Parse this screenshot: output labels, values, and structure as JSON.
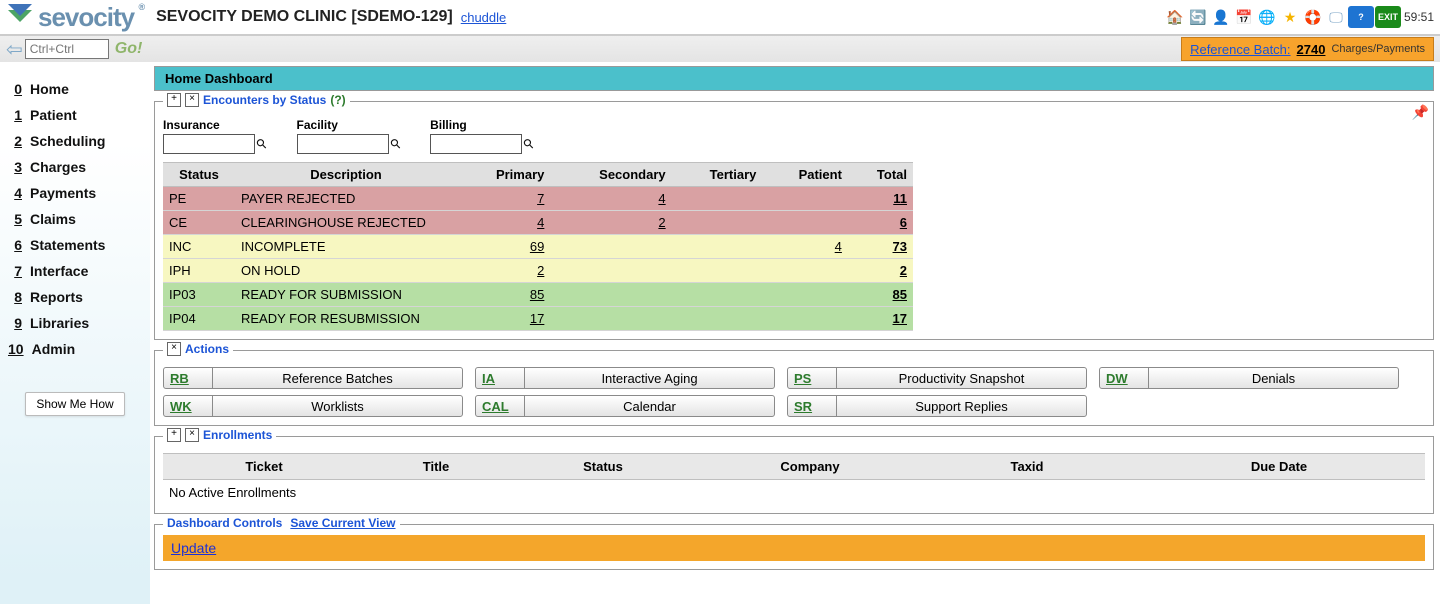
{
  "header": {
    "brand_text": "sevocity",
    "clinic_title": "SEVOCITY DEMO CLINIC [SDEMO-129]",
    "user": "chuddle",
    "clock": "59:51",
    "icons": [
      {
        "name": "home-icon",
        "glyph": "🏠",
        "color": "#f59a21"
      },
      {
        "name": "refresh-icon",
        "glyph": "🔄",
        "color": "#e35b1e"
      },
      {
        "name": "user-icon",
        "glyph": "👤",
        "color": "#7aa3c6"
      },
      {
        "name": "calendar-icon",
        "glyph": "📅",
        "color": "#c94141"
      },
      {
        "name": "globe-icon",
        "glyph": "🌐",
        "color": "#2a6fd1"
      },
      {
        "name": "star-icon",
        "glyph": "★",
        "color": "#f5b400"
      },
      {
        "name": "help-ring-icon",
        "glyph": "🛟",
        "color": "#f07030"
      },
      {
        "name": "monitor-icon",
        "glyph": "🖵",
        "color": "#7aa3c6"
      },
      {
        "name": "help-icon",
        "glyph": "?",
        "color": "#fff",
        "bg": "#1e74d2"
      },
      {
        "name": "exit-icon",
        "glyph": "EXIT",
        "color": "#fff",
        "bg": "#1a8a1a"
      }
    ]
  },
  "searchbar": {
    "placeholder": "Ctrl+Ctrl",
    "go_label": "Go!",
    "ref_label": "Reference Batch:",
    "ref_num": "2740",
    "ref_type": "Charges/Payments"
  },
  "sidebar": {
    "items": [
      {
        "hotkey": "0",
        "label": "Home"
      },
      {
        "hotkey": "1",
        "label": "Patient"
      },
      {
        "hotkey": "2",
        "label": "Scheduling"
      },
      {
        "hotkey": "3",
        "label": "Charges"
      },
      {
        "hotkey": "4",
        "label": "Payments"
      },
      {
        "hotkey": "5",
        "label": "Claims"
      },
      {
        "hotkey": "6",
        "label": "Statements"
      },
      {
        "hotkey": "7",
        "label": "Interface"
      },
      {
        "hotkey": "8",
        "label": "Reports"
      },
      {
        "hotkey": "9",
        "label": "Libraries"
      },
      {
        "hotkey": "10",
        "label": "Admin"
      }
    ],
    "show_me": "Show Me How"
  },
  "dashboard": {
    "title": "Home Dashboard",
    "encounters": {
      "legend": "Encounters by Status",
      "help": "(?)",
      "filters": {
        "insurance": "Insurance",
        "facility": "Facility",
        "billing": "Billing"
      },
      "headers": {
        "status": "Status",
        "description": "Description",
        "primary": "Primary",
        "secondary": "Secondary",
        "tertiary": "Tertiary",
        "patient": "Patient",
        "total": "Total"
      },
      "rows": [
        {
          "status": "PE",
          "description": "PAYER REJECTED",
          "primary": "7",
          "secondary": "4",
          "tertiary": "",
          "patient": "",
          "total": "11",
          "cls": "row-red"
        },
        {
          "status": "CE",
          "description": "CLEARINGHOUSE REJECTED",
          "primary": "4",
          "secondary": "2",
          "tertiary": "",
          "patient": "",
          "total": "6",
          "cls": "row-red"
        },
        {
          "status": "INC",
          "description": "INCOMPLETE",
          "primary": "69",
          "secondary": "",
          "tertiary": "",
          "patient": "4",
          "total": "73",
          "cls": "row-yellow"
        },
        {
          "status": "IPH",
          "description": "ON HOLD",
          "primary": "2",
          "secondary": "",
          "tertiary": "",
          "patient": "",
          "total": "2",
          "cls": "row-yellow"
        },
        {
          "status": "IP03",
          "description": "READY FOR SUBMISSION",
          "primary": "85",
          "secondary": "",
          "tertiary": "",
          "patient": "",
          "total": "85",
          "cls": "row-green"
        },
        {
          "status": "IP04",
          "description": "READY FOR RESUBMISSION",
          "primary": "17",
          "secondary": "",
          "tertiary": "",
          "patient": "",
          "total": "17",
          "cls": "row-green"
        }
      ]
    },
    "actions": {
      "legend": "Actions",
      "items": [
        {
          "abbr": "RB",
          "label": "Reference Batches"
        },
        {
          "abbr": "IA",
          "label": "Interactive Aging"
        },
        {
          "abbr": "PS",
          "label": "Productivity Snapshot"
        },
        {
          "abbr": "DW",
          "label": "Denials"
        },
        {
          "abbr": "WK",
          "label": "Worklists"
        },
        {
          "abbr": "CAL",
          "label": "Calendar"
        },
        {
          "abbr": "SR",
          "label": "Support Replies"
        }
      ]
    },
    "enrollments": {
      "legend": "Enrollments",
      "headers": {
        "ticket": "Ticket",
        "title": "Title",
        "status": "Status",
        "company": "Company",
        "taxid": "Taxid",
        "due": "Due Date"
      },
      "empty": "No Active Enrollments"
    },
    "controls": {
      "legend": "Dashboard Controls",
      "save": "Save Current View",
      "update": "Update"
    }
  }
}
